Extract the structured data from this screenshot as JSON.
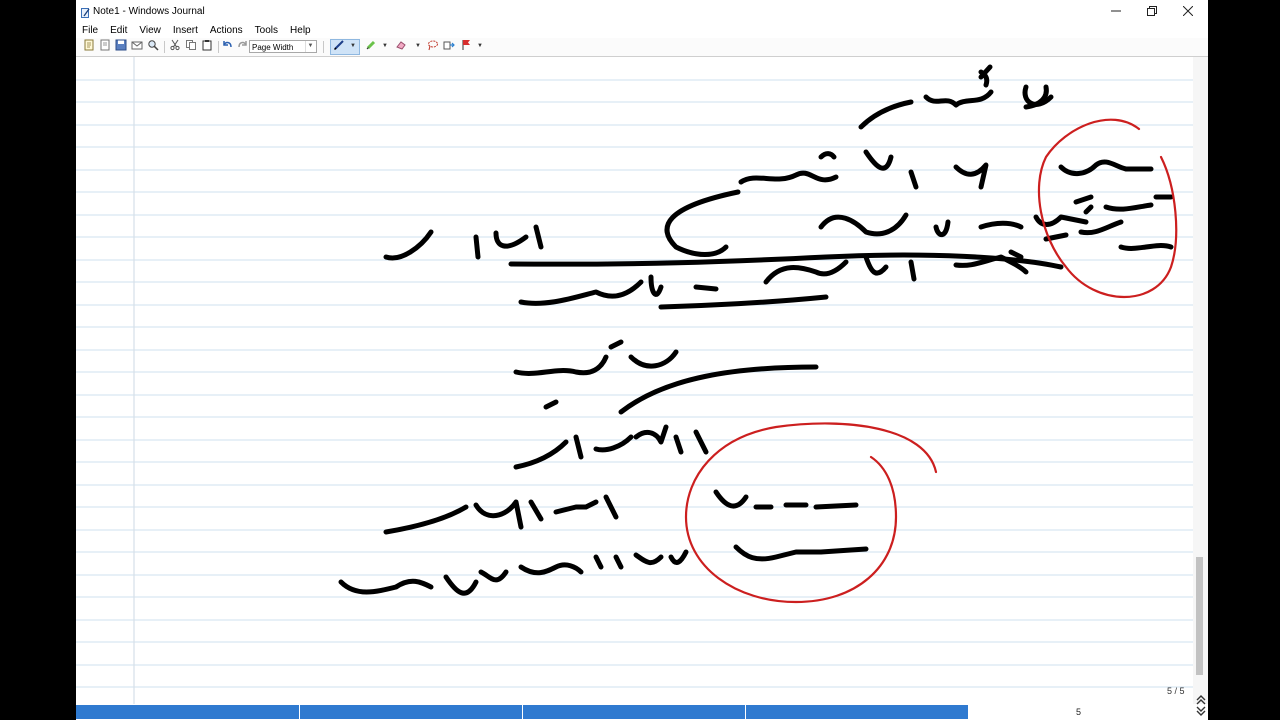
{
  "window": {
    "title": "Note1 - Windows Journal",
    "icons": {
      "app": "journal-app-icon",
      "minimize": "minimize-icon",
      "maximize": "restore-icon",
      "close": "close-icon"
    }
  },
  "menu": {
    "items": [
      "File",
      "Edit",
      "View",
      "Insert",
      "Actions",
      "Tools",
      "Help"
    ]
  },
  "toolbar": {
    "zoom_value": "Page Width",
    "buttons": [
      "new-note-icon",
      "open-icon",
      "save-icon",
      "email-icon",
      "find-icon",
      "cut-icon",
      "copy-icon",
      "paste-icon",
      "undo-icon",
      "redo-icon",
      "pen-icon",
      "highlighter-icon",
      "eraser-icon",
      "lasso-select-icon",
      "insert-space-icon",
      "flag-icon"
    ]
  },
  "page": {
    "counter": "5 / 5",
    "ink_color": "#000000",
    "circle_color": "#cc1f1f",
    "rule_color": "#cfe0ef",
    "margin_line_color": "#d6dfe8"
  },
  "statusbar": {
    "page_number": "5",
    "accent": "#2f7ad0"
  }
}
